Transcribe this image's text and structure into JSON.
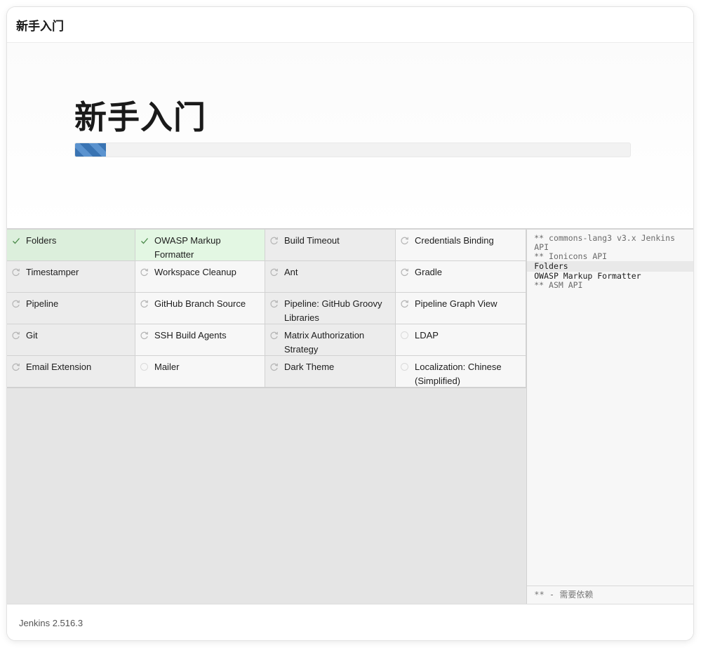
{
  "header": {
    "title": "新手入门"
  },
  "hero": {
    "title": "新手入门",
    "progress_percent": 5.5
  },
  "plugins": [
    {
      "label": "Folders",
      "status": "installed",
      "icon": "check-icon"
    },
    {
      "label": "OWASP Markup Formatter",
      "status": "installed",
      "icon": "check-icon"
    },
    {
      "label": "Build Timeout",
      "status": "pending",
      "icon": "refresh-icon"
    },
    {
      "label": "Credentials Binding",
      "status": "pending",
      "icon": "refresh-icon"
    },
    {
      "label": "Timestamper",
      "status": "pending",
      "icon": "refresh-icon"
    },
    {
      "label": "Workspace Cleanup",
      "status": "pending",
      "icon": "refresh-icon"
    },
    {
      "label": "Ant",
      "status": "pending",
      "icon": "refresh-icon"
    },
    {
      "label": "Gradle",
      "status": "pending",
      "icon": "refresh-icon"
    },
    {
      "label": "Pipeline",
      "status": "pending",
      "icon": "refresh-icon"
    },
    {
      "label": "GitHub Branch Source",
      "status": "pending",
      "icon": "refresh-icon"
    },
    {
      "label": "Pipeline: GitHub Groovy Libraries",
      "status": "pending",
      "icon": "refresh-icon"
    },
    {
      "label": "Pipeline Graph View",
      "status": "pending",
      "icon": "refresh-icon"
    },
    {
      "label": "Git",
      "status": "pending",
      "icon": "refresh-icon"
    },
    {
      "label": "SSH Build Agents",
      "status": "pending",
      "icon": "refresh-icon"
    },
    {
      "label": "Matrix Authorization Strategy",
      "status": "pending",
      "icon": "refresh-icon"
    },
    {
      "label": "LDAP",
      "status": "queued",
      "icon": "circle-icon"
    },
    {
      "label": "Email Extension",
      "status": "pending",
      "icon": "refresh-icon"
    },
    {
      "label": "Mailer",
      "status": "queued",
      "icon": "circle-icon"
    },
    {
      "label": "Dark Theme",
      "status": "pending",
      "icon": "refresh-icon"
    },
    {
      "label": "Localization: Chinese (Simplified)",
      "status": "queued",
      "icon": "circle-icon"
    }
  ],
  "log": {
    "lines": [
      {
        "text": "** commons-lang3 v3.x Jenkins API",
        "type": "dependency"
      },
      {
        "text": "** Ionicons API",
        "type": "dependency"
      },
      {
        "text": "Folders",
        "type": "installed"
      },
      {
        "text": "OWASP Markup Formatter",
        "type": "installed"
      },
      {
        "text": "** ASM API",
        "type": "dependency"
      }
    ],
    "footer": "** - 需要依赖"
  },
  "footer": {
    "version": "Jenkins 2.516.3"
  },
  "colors": {
    "progress": "#3a74b3",
    "installed_bg": "#dcefdc",
    "check": "#3a8a3a"
  }
}
